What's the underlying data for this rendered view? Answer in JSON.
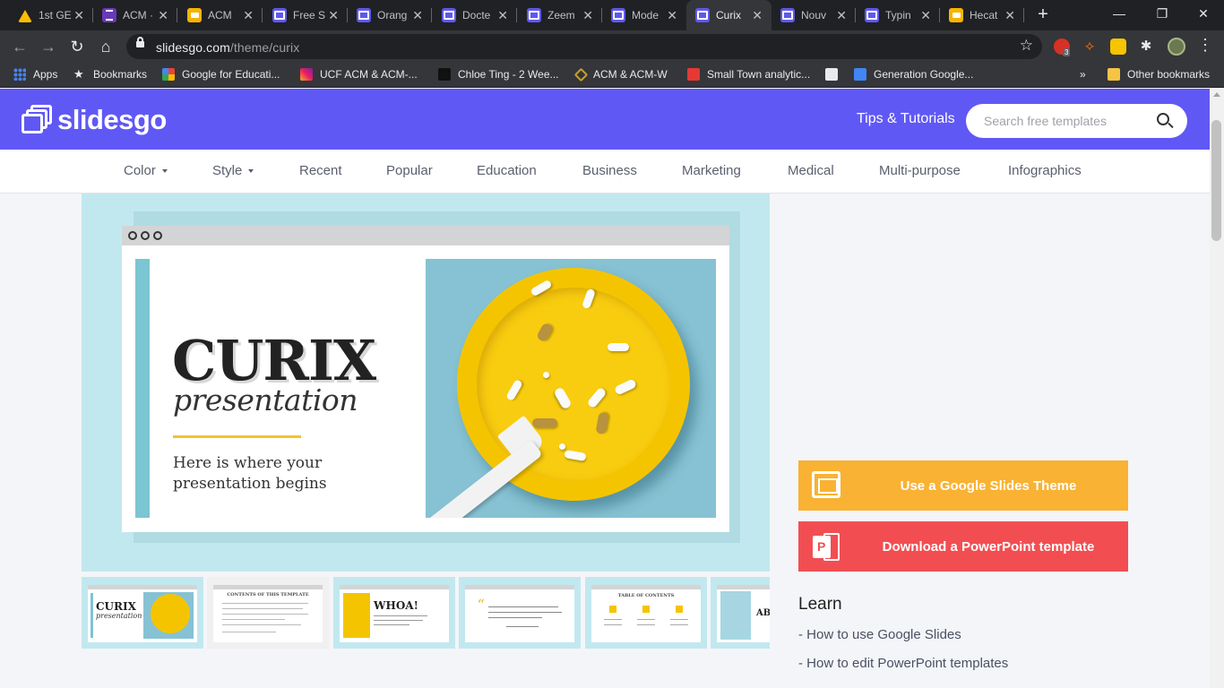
{
  "browser": {
    "tabs": [
      {
        "title": "1st GE",
        "icon": "drive-icon",
        "active": false
      },
      {
        "title": "ACM ·",
        "icon": "forms-icon",
        "active": false
      },
      {
        "title": "ACM",
        "icon": "slides-icon",
        "active": false
      },
      {
        "title": "Free S",
        "icon": "slidesgo-icon",
        "active": false
      },
      {
        "title": "Orang",
        "icon": "slidesgo-icon",
        "active": false
      },
      {
        "title": "Docte",
        "icon": "slidesgo-icon",
        "active": false
      },
      {
        "title": "Zeem",
        "icon": "slidesgo-icon",
        "active": false
      },
      {
        "title": "Mode",
        "icon": "slidesgo-icon",
        "active": false
      },
      {
        "title": "Curix",
        "icon": "slidesgo-icon",
        "active": true
      },
      {
        "title": "Nouv",
        "icon": "slidesgo-icon",
        "active": false
      },
      {
        "title": "Typin",
        "icon": "slidesgo-icon",
        "active": false
      },
      {
        "title": "Hecat",
        "icon": "slides-icon",
        "active": false
      }
    ],
    "url_host": "slidesgo.com",
    "url_path": "/theme/curix",
    "ext_badge": "3",
    "bookmarks": [
      {
        "label": "Apps",
        "icon": "apps-grid-icon"
      },
      {
        "label": "Bookmarks",
        "icon": "star-icon"
      },
      {
        "label": "Google for Educati...",
        "icon": "google-icon"
      },
      {
        "label": "UCF ACM & ACM-...",
        "icon": "instagram-icon"
      },
      {
        "label": "Chloe Ting - 2 Wee...",
        "icon": "chloe-ting-icon"
      },
      {
        "label": "ACM & ACM-W",
        "icon": "acm-diamond-icon"
      },
      {
        "label": "Small Town analytic...",
        "icon": "shop-icon"
      },
      {
        "label": "",
        "icon": "globe-icon"
      },
      {
        "label": "Generation Google...",
        "icon": "docs-icon"
      }
    ],
    "bookmarks_overflow": "»",
    "other_bookmarks": "Other bookmarks"
  },
  "site": {
    "logo_text": "slidesgo",
    "tips_link": "Tips & Tutorials",
    "search_placeholder": "Search free templates",
    "categories": [
      "Color",
      "Style",
      "Recent",
      "Popular",
      "Education",
      "Business",
      "Marketing",
      "Medical",
      "Multi-purpose",
      "Infographics"
    ]
  },
  "preview": {
    "title": "CURIX",
    "subtitle": "presentation",
    "tagline": "Here is where your presentation begins",
    "thumbs": {
      "t1_title": "CURIX",
      "t1_sub": "presentation",
      "t2_title": "CONTENTS OF THIS TEMPLATE",
      "t3_title": "WHOA!",
      "t5_title": "TABLE OF CONTENTS",
      "t6_title": "ABO"
    }
  },
  "actions": {
    "google_slides": "Use a Google Slides Theme",
    "powerpoint": "Download a PowerPoint template"
  },
  "learn": {
    "heading": "Learn",
    "links": [
      "- How to use Google Slides",
      "- How to edit PowerPoint templates"
    ]
  },
  "colors": {
    "brand": "#6058f5",
    "google_slides_button": "#f9b233",
    "powerpoint_button": "#f24e52",
    "hero_bg": "#c2e8ef"
  }
}
